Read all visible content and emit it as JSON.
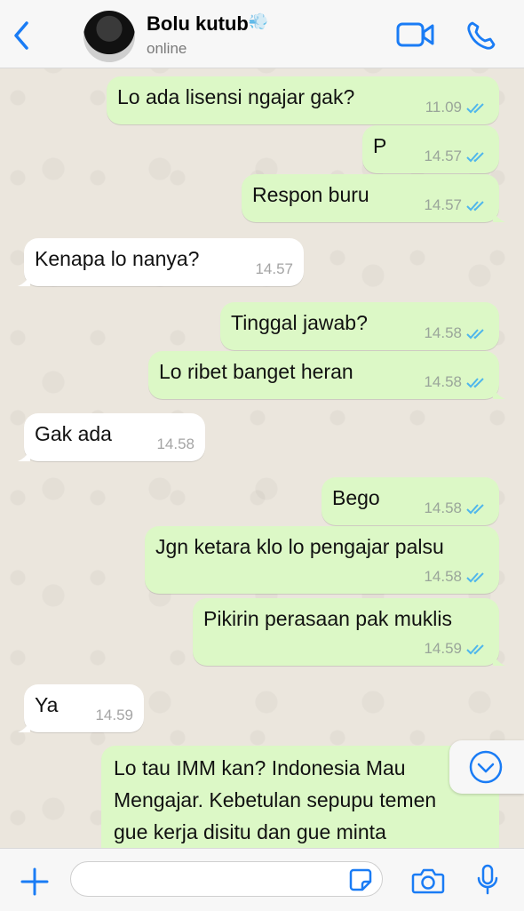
{
  "header": {
    "contact_name": "Bolu kutub",
    "name_emoji": "💨",
    "status": "online"
  },
  "icons": {
    "back": "chevron-left-icon",
    "video": "video-camera-icon",
    "phone": "phone-icon",
    "plus": "plus-icon",
    "sticker": "sticker-icon",
    "camera": "camera-icon",
    "mic": "microphone-icon",
    "scroll": "chevron-down-circle-icon",
    "read_receipt": "double-check-icon"
  },
  "colors": {
    "accent": "#1a7cf5",
    "outgoing_bubble": "#dcf8c6",
    "incoming_bubble": "#ffffff",
    "read_tick": "#4fb6ec"
  },
  "messages": [
    {
      "dir": "out",
      "text": "Lo ada lisensi ngajar gak?",
      "time": "11.09"
    },
    {
      "dir": "out",
      "text": "P",
      "time": "14.57"
    },
    {
      "dir": "out",
      "text": "Respon buru",
      "time": "14.57"
    },
    {
      "dir": "in",
      "text": "Kenapa lo nanya?",
      "time": "14.57"
    },
    {
      "dir": "out",
      "text": "Tinggal jawab?",
      "time": "14.58"
    },
    {
      "dir": "out",
      "text": "Lo ribet banget heran",
      "time": "14.58"
    },
    {
      "dir": "in",
      "text": "Gak ada",
      "time": "14.58"
    },
    {
      "dir": "out",
      "text": "Bego",
      "time": "14.58"
    },
    {
      "dir": "out",
      "text": "Jgn ketara klo lo pengajar palsu",
      "time": "14.58"
    },
    {
      "dir": "out",
      "text": "Pikirin perasaan pak muklis",
      "time": "14.59"
    },
    {
      "dir": "in",
      "text": "Ya",
      "time": "14.59"
    }
  ],
  "partial_message": {
    "dir": "out",
    "lines": [
      "Lo tau IMM kan? Indonesia Mau",
      "Mengajar. Kebetulan sepupu temen",
      "gue kerja disitu dan gue minta"
    ]
  },
  "composer": {
    "placeholder": "",
    "value": ""
  }
}
